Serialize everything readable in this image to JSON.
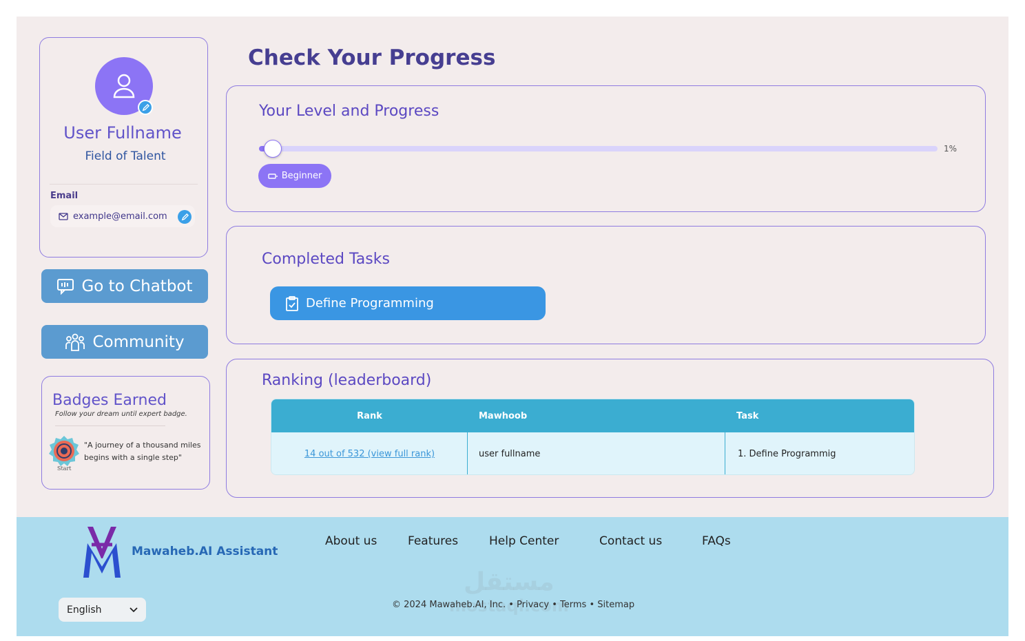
{
  "profile": {
    "name": "User Fullname",
    "field": "Field of Talent",
    "email_label": "Email",
    "email": "example@email.com"
  },
  "sidebar": {
    "chatbot_label": "Go to Chatbot",
    "community_label": "Community"
  },
  "badges": {
    "title": "Badges Earned",
    "subtitle": "Follow your dream until expert badge.",
    "badge_caption": "Start",
    "quote": "\"A journey of a thousand miles begins with a single step\""
  },
  "main": {
    "title": "Check Your Progress",
    "level": {
      "title": "Your Level and Progress",
      "progress_percent": 1,
      "percent_label": "1%",
      "level_name": "Beginner"
    },
    "tasks": {
      "title": "Completed Tasks",
      "items": [
        "Define Programming"
      ]
    },
    "ranking": {
      "title": "Ranking (leaderboard)",
      "columns": [
        "Rank",
        "Mawhoob",
        "Task"
      ],
      "rows": [
        {
          "rank": "14  out of 532 (view full rank)",
          "mawhoob": "user fullname",
          "task": "1.  Define Programmig"
        }
      ]
    }
  },
  "footer": {
    "brand": "Mawaheb.AI Assistant",
    "nav": [
      "About us",
      "Features",
      "Help Center",
      "Contact us",
      "FAQs"
    ],
    "language": "English",
    "copyright": "© 2024 Mawaheb.AI, Inc. • Privacy • Terms • Sitemap",
    "watermark_top": "مستقل",
    "watermark_bottom": "mostaql.com"
  },
  "colors": {
    "primary_purple": "#8c74f5",
    "heading_purple": "#463e91",
    "button_blue": "#5b9bd0",
    "task_blue": "#3a96e3",
    "table_header": "#3badd1",
    "footer_bg": "#addcee"
  }
}
